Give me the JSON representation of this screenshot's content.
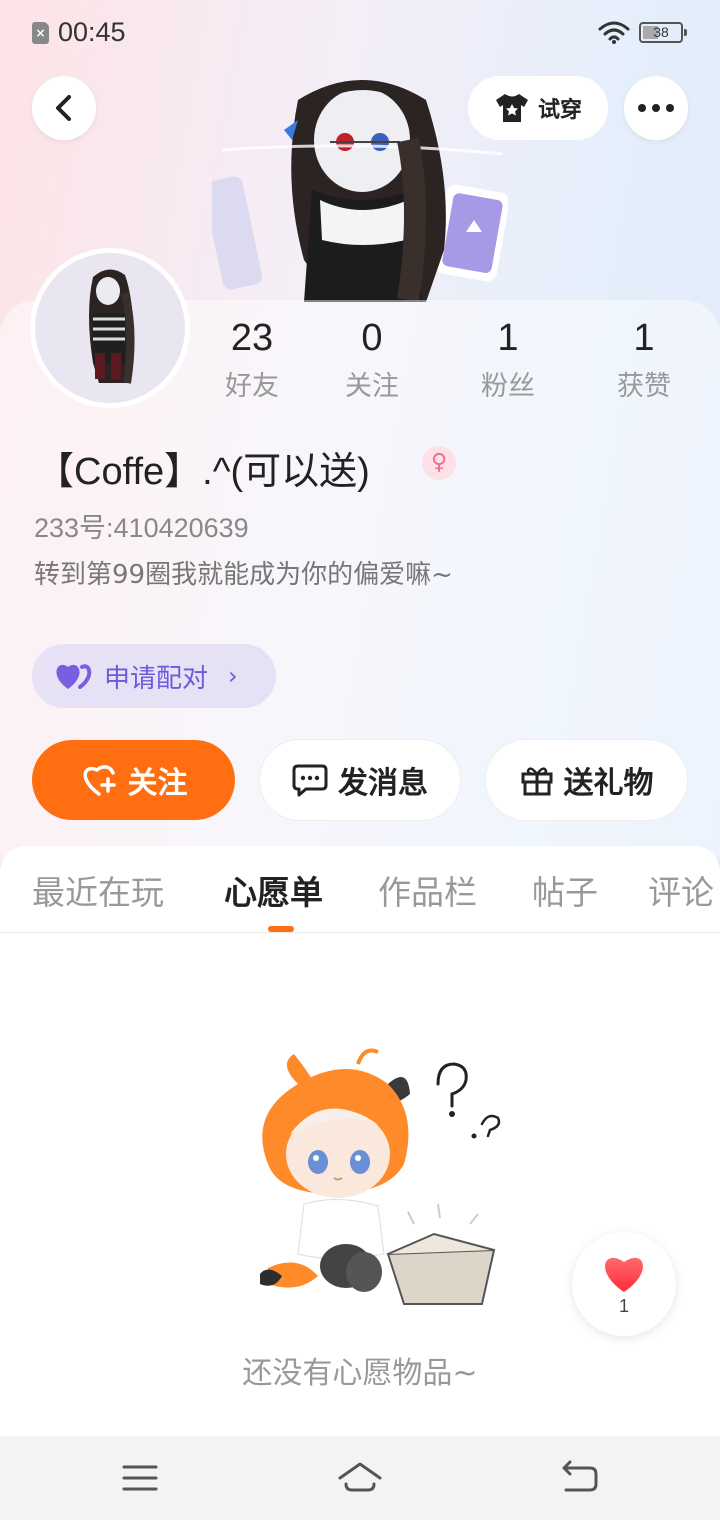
{
  "status_bar": {
    "time": "00:45",
    "battery": "38"
  },
  "header": {
    "try_on_label": "试穿"
  },
  "stats": [
    {
      "value": "23",
      "label": "好友"
    },
    {
      "value": "0",
      "label": "关注"
    },
    {
      "value": "1",
      "label": "粉丝"
    },
    {
      "value": "1",
      "label": "获赞"
    }
  ],
  "profile": {
    "username": "【Coffe】.^(可以送)",
    "gender_symbol": "♀",
    "user_id": "233号:410420639",
    "bio": "转到第99圈我就能成为你的偏爱嘛~",
    "pair_label": "申请配对"
  },
  "actions": {
    "follow": "关注",
    "message": "发消息",
    "gift": "送礼物"
  },
  "tabs": [
    {
      "label": "最近在玩"
    },
    {
      "label": "心愿单"
    },
    {
      "label": "作品栏"
    },
    {
      "label": "帖子"
    },
    {
      "label": "评论"
    }
  ],
  "active_tab": "心愿单",
  "empty_state": {
    "text": "还没有心愿物品~"
  },
  "like_fab": {
    "count": "1"
  },
  "colors": {
    "accent": "#ff6f12",
    "pair": "#6f5ad9",
    "muted": "#999999"
  }
}
